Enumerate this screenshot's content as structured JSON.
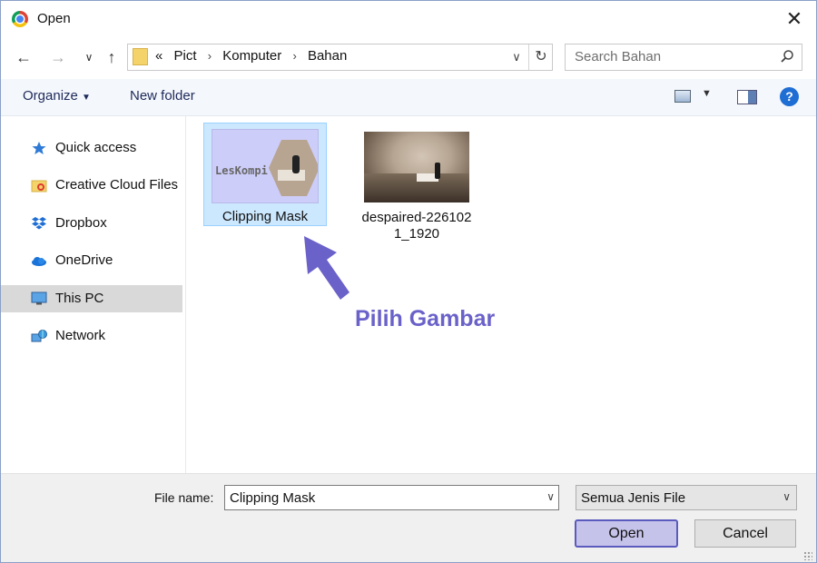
{
  "window": {
    "title": "Open",
    "close_icon": "close-icon"
  },
  "nav": {
    "back_icon": "arrow-left-icon",
    "forward_icon": "arrow-right-icon",
    "recent_icon": "chevron-down-icon",
    "up_icon": "arrow-up-icon"
  },
  "address": {
    "overflow": "«",
    "crumbs": [
      "Pict",
      "Komputer",
      "Bahan"
    ],
    "refresh_icon": "refresh-icon"
  },
  "search": {
    "placeholder": "Search Bahan",
    "icon": "search-icon"
  },
  "toolbar": {
    "organize_label": "Organize",
    "new_folder_label": "New folder",
    "help_label": "?"
  },
  "sidebar": {
    "items": [
      {
        "label": "Quick access",
        "icon": "star-icon",
        "selected": false
      },
      {
        "label": "Creative Cloud Files",
        "icon": "creative-cloud-folder-icon",
        "selected": false
      },
      {
        "label": "Dropbox",
        "icon": "dropbox-icon",
        "selected": false
      },
      {
        "label": "OneDrive",
        "icon": "onedrive-cloud-icon",
        "selected": false
      },
      {
        "label": "This PC",
        "icon": "monitor-icon",
        "selected": true
      },
      {
        "label": "Network",
        "icon": "network-icon",
        "selected": false
      }
    ]
  },
  "files": [
    {
      "name": "Clipping Mask",
      "selected": true,
      "thumb_text": "LesKompi"
    },
    {
      "name_line1": "despaired-226102",
      "name_line2": "1_1920",
      "selected": false
    }
  ],
  "annotation": {
    "text": "Pilih Gambar",
    "color": "#6a62c9"
  },
  "footer": {
    "file_name_label": "File name:",
    "file_name_value": "Clipping Mask",
    "file_type_value": "Semua Jenis File",
    "open_label": "Open",
    "cancel_label": "Cancel"
  },
  "colors": {
    "accent": "#1f6ed4",
    "selection": "#cce8ff",
    "annotation": "#6a62c9"
  }
}
